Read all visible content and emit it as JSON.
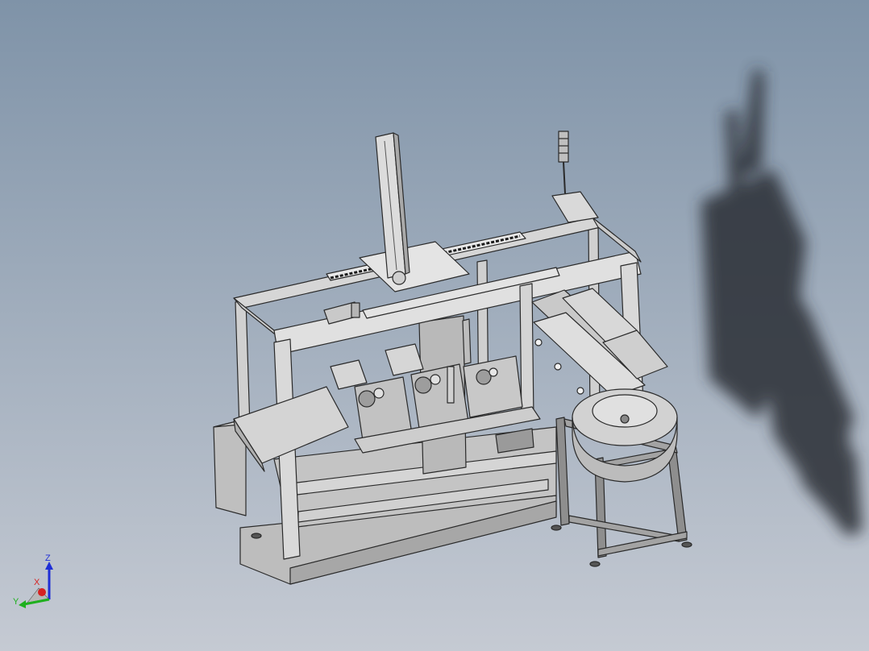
{
  "viewport": {
    "background_top": "#7f93a8",
    "background_bottom": "#c5cad3",
    "model_fill": "#c8c8c8",
    "model_edge": "#2a2a2a",
    "shadow_color": "#2b2f35"
  },
  "triad": {
    "z_label": "Z",
    "x_label": "X",
    "y_label": "Y",
    "z_color": "#1f2fd6",
    "x_color": "#d62222",
    "y_color": "#1fb01f"
  }
}
